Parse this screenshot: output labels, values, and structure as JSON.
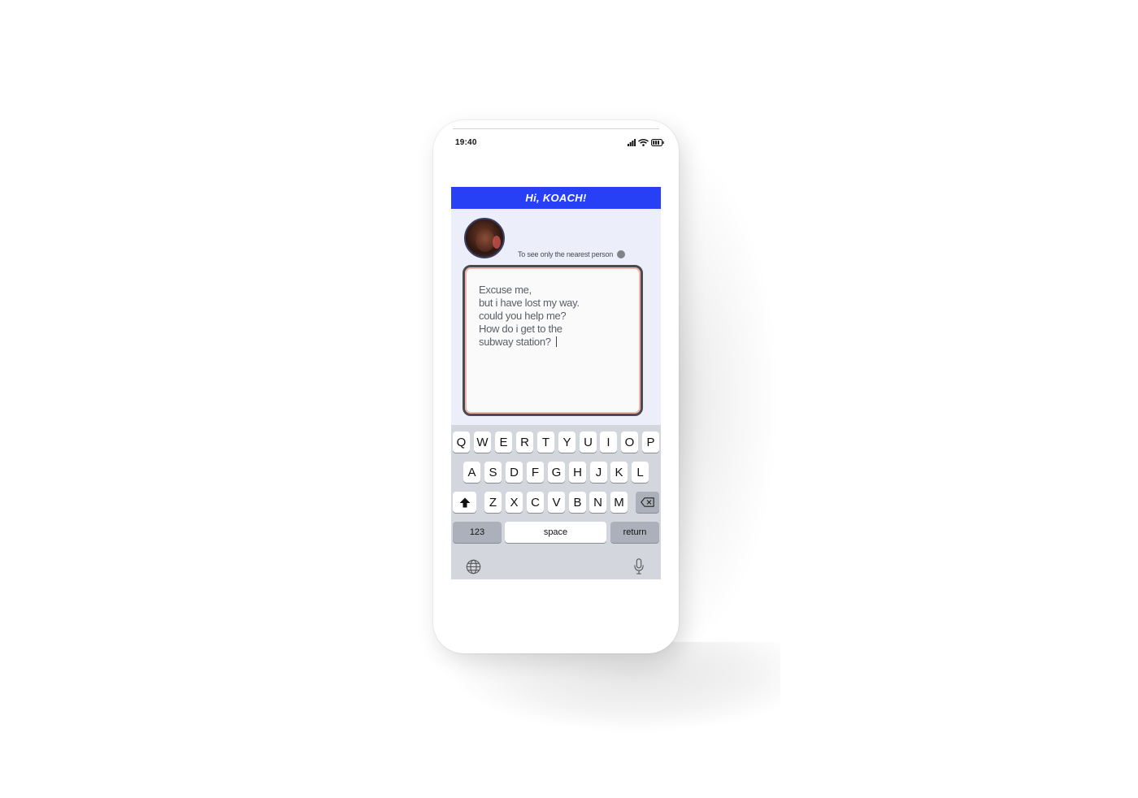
{
  "status_bar": {
    "time": "19:40"
  },
  "app": {
    "title": "Hi, KOACH!",
    "nearest_label": "To see only the nearest person",
    "message_lines": [
      "Excuse me,",
      "but i have lost my way.",
      "could you help me?",
      "How do i get to the",
      "subway station?"
    ]
  },
  "keyboard": {
    "row1": [
      "Q",
      "W",
      "E",
      "R",
      "T",
      "Y",
      "U",
      "I",
      "O",
      "P"
    ],
    "row2": [
      "A",
      "S",
      "D",
      "F",
      "G",
      "H",
      "J",
      "K",
      "L"
    ],
    "row3": [
      "Z",
      "X",
      "C",
      "V",
      "B",
      "N",
      "M"
    ],
    "numbers_label": "123",
    "space_label": "space",
    "return_label": "return"
  },
  "colors": {
    "header_blue": "#2740f5",
    "app_background": "#eceff9",
    "keyboard_background": "#d3d6dd"
  },
  "icons": [
    "cellular-signal-icon",
    "wifi-icon",
    "battery-icon",
    "shift-icon",
    "backspace-icon",
    "globe-icon",
    "microphone-icon"
  ]
}
